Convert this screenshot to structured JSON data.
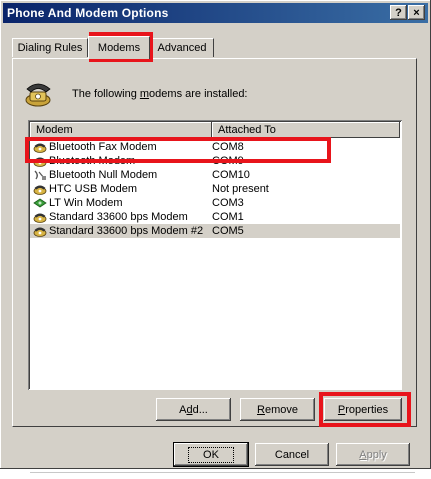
{
  "window": {
    "title": "Phone And Modem Options",
    "help_label": "?",
    "close_label": "×"
  },
  "tabs": [
    {
      "label": "Dialing Rules"
    },
    {
      "label": "Modems"
    },
    {
      "label": "Advanced"
    }
  ],
  "intro": {
    "text_before": "The following ",
    "text_underlined": "m",
    "text_after": "odems are  installed:"
  },
  "list": {
    "columns": [
      "Modem",
      "Attached To"
    ],
    "rows": [
      {
        "name": "Bluetooth Fax Modem",
        "port": "COM8",
        "icon": "modem-icon"
      },
      {
        "name": "Bluetooth Modem",
        "port": "COM9",
        "icon": "modem-icon"
      },
      {
        "name": "Bluetooth Null Modem",
        "port": "COM10",
        "icon": "null-modem-icon"
      },
      {
        "name": "HTC USB Modem",
        "port": "Not present",
        "icon": "modem-icon"
      },
      {
        "name": "LT Win Modem",
        "port": "COM3",
        "icon": "winmodem-icon"
      },
      {
        "name": "Standard 33600 bps Modem",
        "port": "COM1",
        "icon": "modem-icon"
      },
      {
        "name": "Standard 33600 bps Modem #2",
        "port": "COM5",
        "icon": "modem-icon"
      }
    ],
    "selected_row": 6
  },
  "buttons": {
    "add": {
      "pre": "A",
      "u": "d",
      "post": "d..."
    },
    "remove": {
      "pre": "",
      "u": "R",
      "post": "emove"
    },
    "properties": {
      "pre": "",
      "u": "P",
      "post": "roperties"
    },
    "ok": "OK",
    "cancel": "Cancel",
    "apply": {
      "pre": "",
      "u": "A",
      "post": "pply"
    }
  },
  "colors": {
    "highlight": "#e8141b",
    "title_start": "#0a246a",
    "title_end": "#3a6ea5"
  }
}
